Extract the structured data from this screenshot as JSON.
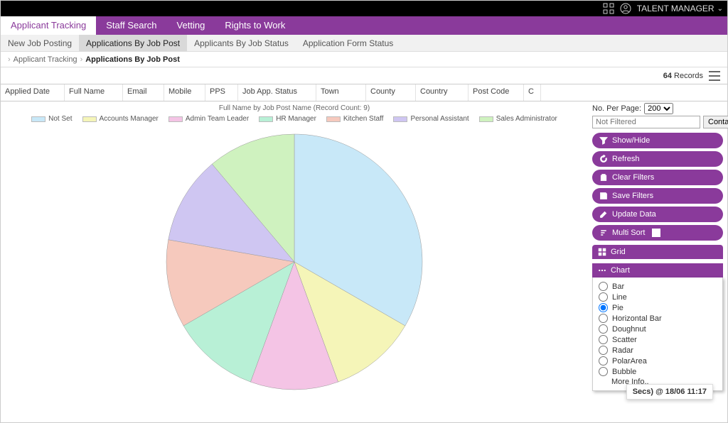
{
  "header": {
    "user_label": "TALENT MANAGER"
  },
  "tabs": [
    {
      "label": "Applicant Tracking",
      "active": true
    },
    {
      "label": "Staff Search",
      "active": false
    },
    {
      "label": "Vetting",
      "active": false
    },
    {
      "label": "Rights to Work",
      "active": false
    }
  ],
  "subtabs": [
    {
      "label": "New Job Posting",
      "active": false
    },
    {
      "label": "Applications By Job Post",
      "active": true
    },
    {
      "label": "Applicants By Job Status",
      "active": false
    },
    {
      "label": "Application Form Status",
      "active": false
    }
  ],
  "breadcrumb": {
    "parent": "Applicant Tracking",
    "current": "Applications By Job Post"
  },
  "record_count": "64",
  "record_count_label": " Records",
  "columns": [
    "Applied Date",
    "Full Name",
    "Email",
    "Mobile",
    "PPS",
    "Job App. Status",
    "Town",
    "County",
    "Country",
    "Post Code",
    "C"
  ],
  "chart_data": {
    "type": "pie",
    "title": "Full Name by Job Post Name (Record Count: 9)",
    "categories": [
      "Not Set",
      "Accounts Manager",
      "Admin Team Leader",
      "HR Manager",
      "Kitchen Staff",
      "Personal Assistant",
      "Sales Administrator"
    ],
    "values": [
      3,
      1,
      1,
      1,
      1,
      1,
      1
    ],
    "colors": [
      "#c8e8f8",
      "#f5f5b8",
      "#f4c4e5",
      "#b8f0d6",
      "#f6c9bd",
      "#cfc6f2",
      "#cff2bf"
    ]
  },
  "sidebar": {
    "per_page_label": "No. Per Page:",
    "per_page_value": "200",
    "filter_placeholder": "Not Filtered",
    "filter_mode_label": "Contains",
    "buttons": {
      "showhide": "Show/Hide",
      "refresh": "Refresh",
      "clear": "Clear Filters",
      "save": "Save Filters",
      "update": "Update Data",
      "multisort": "Multi Sort"
    },
    "grid_label": "Grid",
    "chart_label": "Chart",
    "chart_types": [
      "Bar",
      "Line",
      "Pie",
      "Horizontal Bar",
      "Doughnut",
      "Scatter",
      "Radar",
      "PolarArea",
      "Bubble"
    ],
    "chart_type_selected": "Pie",
    "more_info": "More Info.."
  },
  "toast": " Secs) @ 18/06 11:17"
}
